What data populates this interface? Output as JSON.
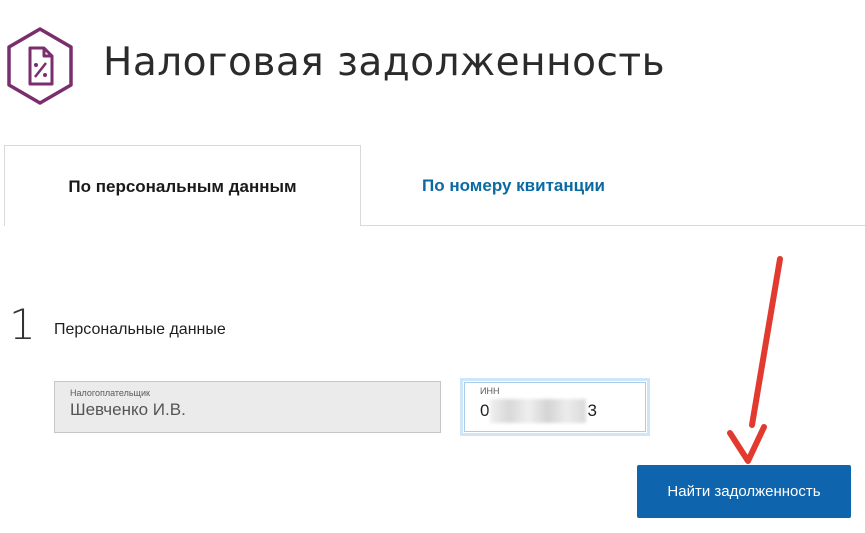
{
  "header": {
    "title": "Налоговая задолженность",
    "logo_icon": "percent-document-icon",
    "logo_color": "#7a2e6e"
  },
  "tabs": [
    {
      "label": "По персональным данным",
      "active": true
    },
    {
      "label": "По номеру квитанции",
      "active": false
    }
  ],
  "step": {
    "number": "1",
    "title": "Персональные данные"
  },
  "fields": {
    "payer": {
      "label": "Налогоплательщик",
      "value": "Шевченко И.В."
    },
    "inn": {
      "label": "ИНН",
      "value_prefix": "0",
      "value_suffix": "3"
    }
  },
  "actions": {
    "find_label": "Найти задолженность",
    "accent_color": "#0e65ad"
  },
  "annotation": {
    "arrow_icon": "red-arrow-icon",
    "color": "#e23a2e"
  }
}
